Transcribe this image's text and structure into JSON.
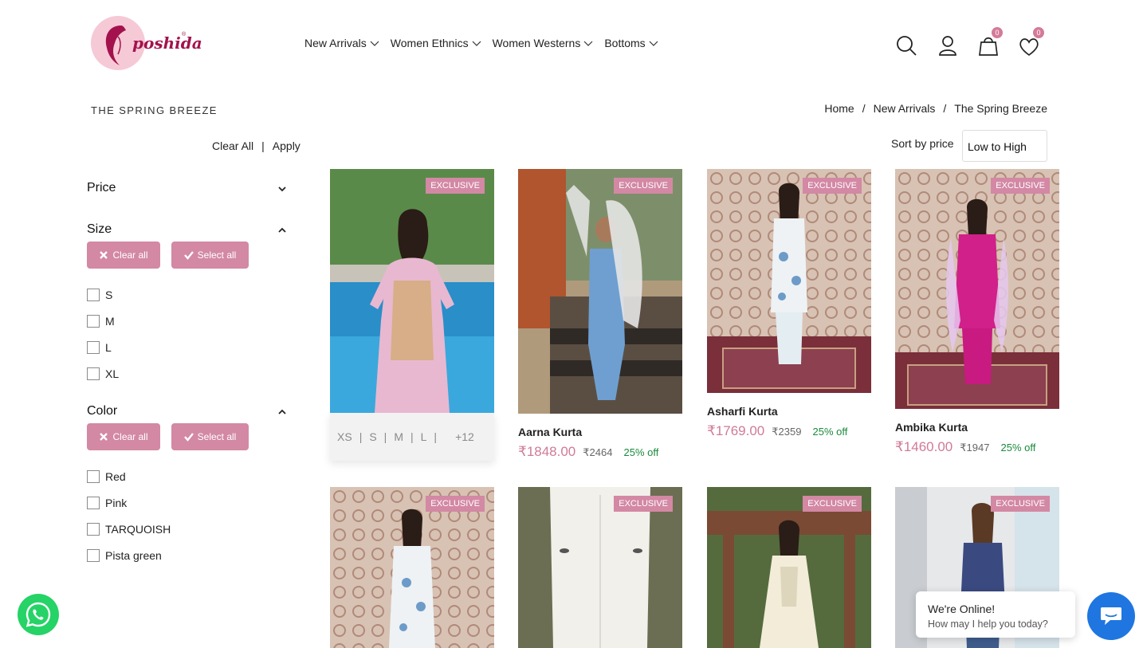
{
  "brand": {
    "logo_text": "poshida",
    "reg": "®"
  },
  "nav": [
    {
      "label": "New Arrivals"
    },
    {
      "label": "Women Ethnics"
    },
    {
      "label": "Women Westerns"
    },
    {
      "label": "Bottoms"
    }
  ],
  "header_icons": {
    "cart_count": "0",
    "wishlist_count": "0"
  },
  "page_title": "THE SPRING BREEZE",
  "breadcrumb": {
    "home": "Home",
    "sep1": "/",
    "level1": "New Arrivals",
    "sep2": "/",
    "current": "The Spring Breeze"
  },
  "filter_actions": {
    "clear": "Clear All",
    "sep": "|",
    "apply": "Apply"
  },
  "filters": {
    "price": {
      "title": "Price"
    },
    "size": {
      "title": "Size",
      "clear_label": "Clear all",
      "select_label": "Select all",
      "options": [
        "S",
        "M",
        "L",
        "XL"
      ]
    },
    "color": {
      "title": "Color",
      "clear_label": "Clear all",
      "select_label": "Select all",
      "options": [
        "Red",
        "Pink",
        "TARQUOISH",
        "Pista green"
      ]
    }
  },
  "sort": {
    "label": "Sort by price",
    "value": "Low to High"
  },
  "products": [
    {
      "tag": "EXCLUSIVE",
      "sizes": [
        "XS",
        "|",
        "S",
        "|",
        "M",
        "|",
        "L",
        "|"
      ],
      "more_sizes": "+12"
    },
    {
      "tag": "EXCLUSIVE",
      "name": "Aarna Kurta",
      "price": "₹1848.00",
      "mrp": "₹2464",
      "off": "25% off"
    },
    {
      "tag": "EXCLUSIVE",
      "name": "Asharfi Kurta",
      "price": "₹1769.00",
      "mrp": "₹2359",
      "off": "25% off"
    },
    {
      "tag": "EXCLUSIVE",
      "name": "Ambika Kurta",
      "price": "₹1460.00",
      "mrp": "₹1947",
      "off": "25% off"
    },
    {
      "tag": "EXCLUSIVE"
    },
    {
      "tag": "EXCLUSIVE"
    },
    {
      "tag": "EXCLUSIVE"
    },
    {
      "tag": "EXCLUSIVE"
    }
  ],
  "chat": {
    "title": "We're Online!",
    "subtitle": "How may I help you today?"
  },
  "colors": {
    "accent_pink": "#d388a4",
    "price_pink": "#d07a99",
    "discount_green": "#1a8a3c",
    "whatsapp_green": "#25d366",
    "chat_blue": "#1f76e0"
  }
}
